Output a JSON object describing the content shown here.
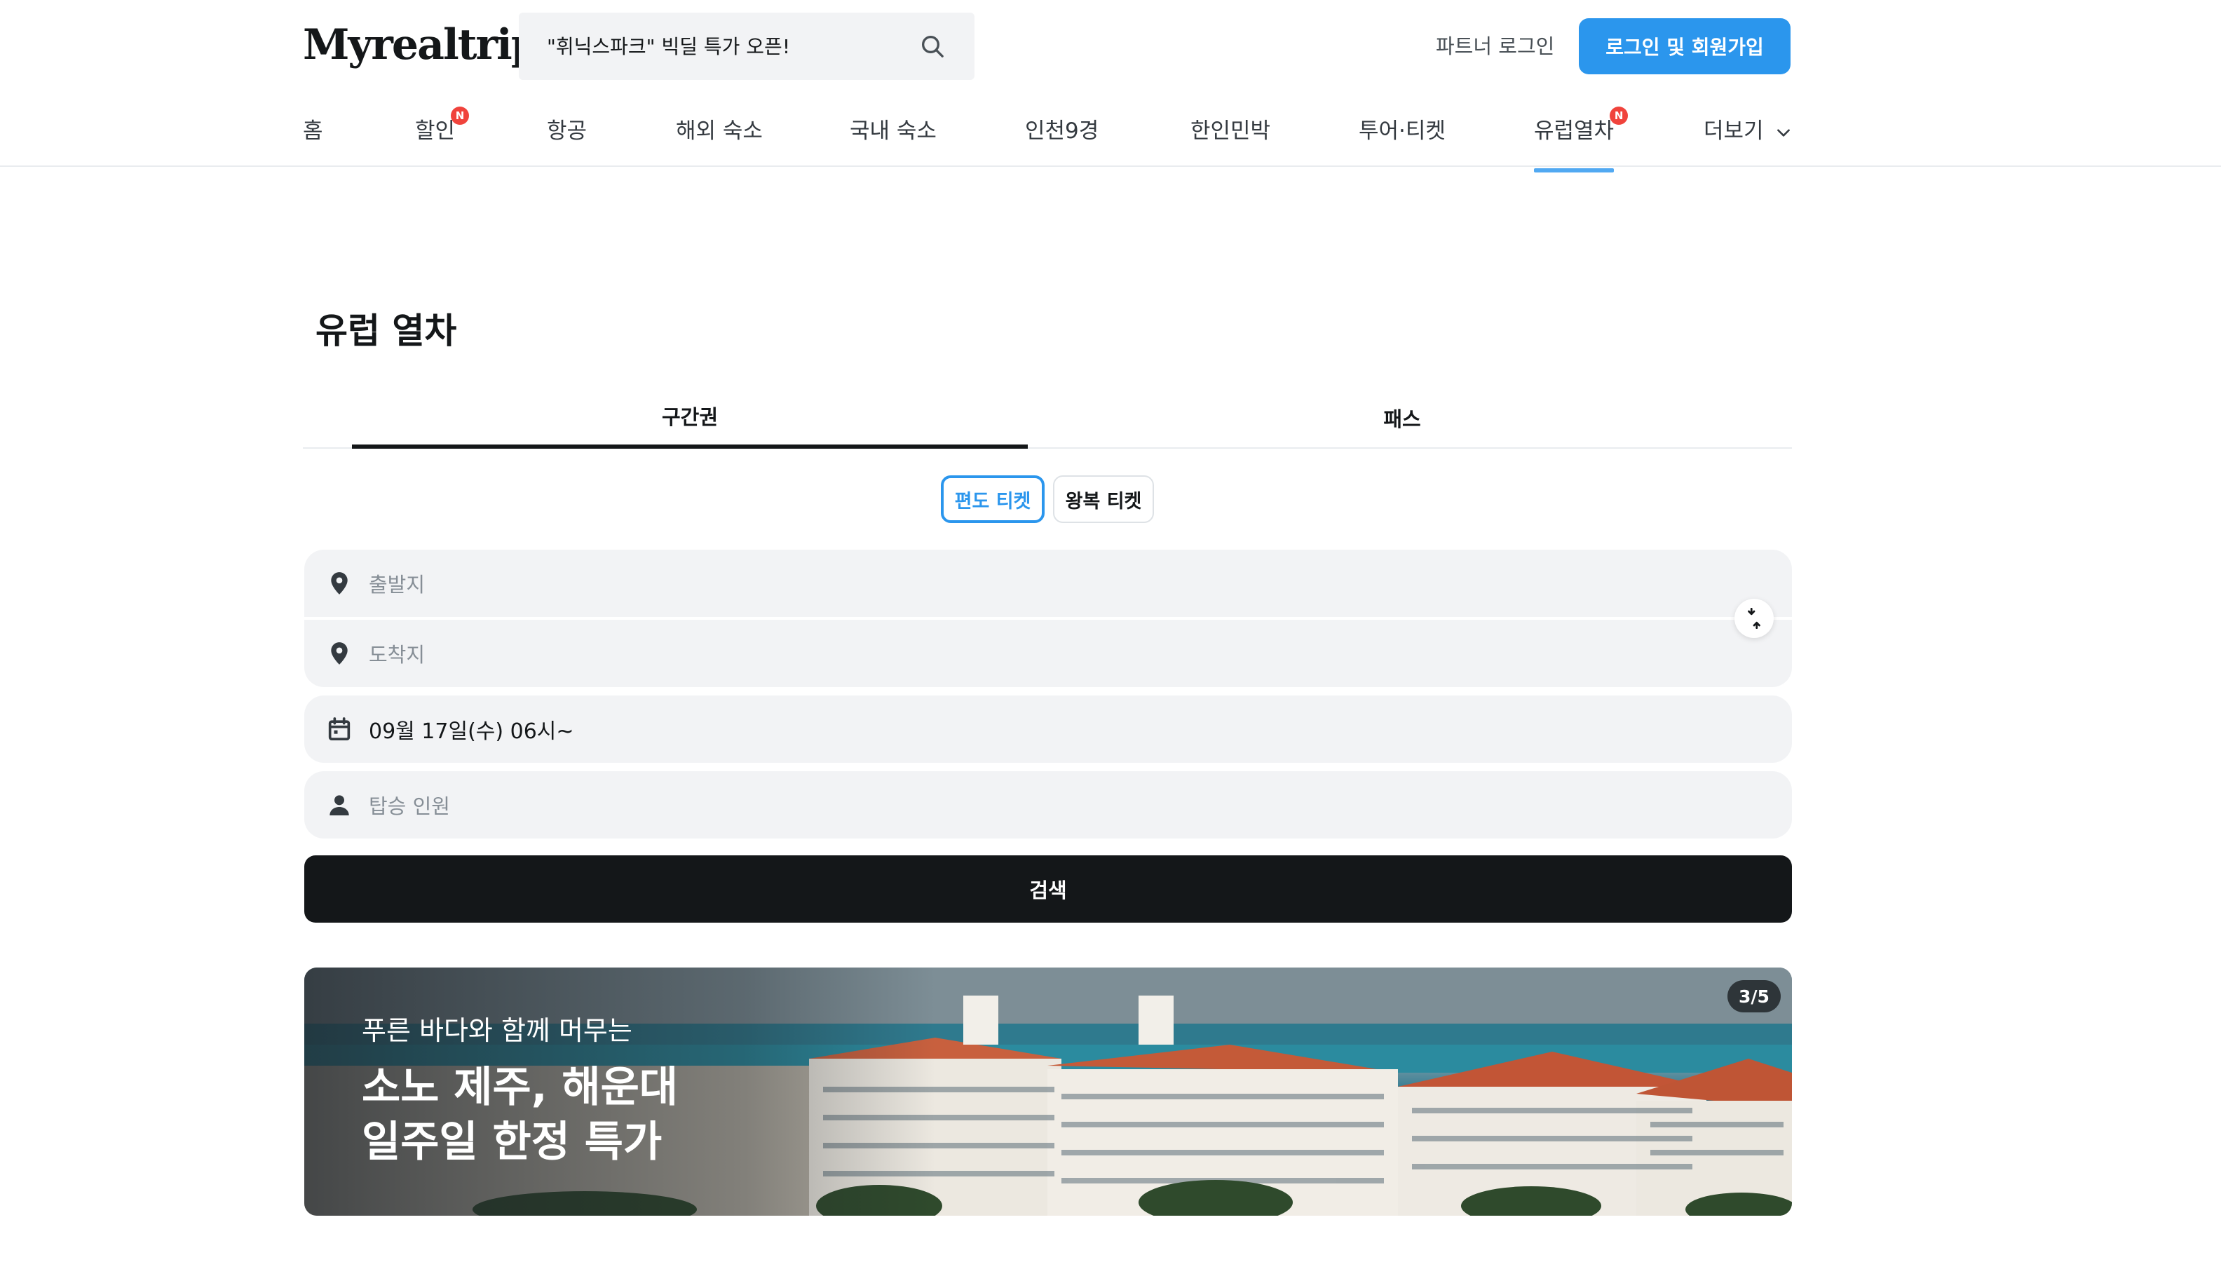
{
  "header": {
    "logo": "Myrealtrip",
    "search_placeholder": "\"휘닉스파크\" 빅딜 특가 오픈!",
    "partner_login": "파트너 로그인",
    "login_signup": "로그인 및 회원가입"
  },
  "nav": {
    "items": [
      {
        "label": "홈"
      },
      {
        "label": "할인",
        "badge": "N"
      },
      {
        "label": "항공"
      },
      {
        "label": "해외 숙소"
      },
      {
        "label": "국내 숙소"
      },
      {
        "label": "인천9경"
      },
      {
        "label": "한인민박"
      },
      {
        "label": "투어·티켓"
      },
      {
        "label": "유럽열차",
        "badge": "N",
        "active": true
      },
      {
        "label": "더보기"
      }
    ]
  },
  "page": {
    "title": "유럽 열차",
    "tabs": [
      {
        "label": "구간권",
        "active": true
      },
      {
        "label": "패스"
      }
    ],
    "ticket_types": [
      {
        "label": "편도 티켓",
        "selected": true
      },
      {
        "label": "왕복 티켓"
      }
    ],
    "form": {
      "departure_placeholder": "출발지",
      "arrival_placeholder": "도착지",
      "date_value": "09월 17일(수) 06시~",
      "passengers_placeholder": "탑승 인원",
      "search_label": "검색"
    }
  },
  "banner": {
    "subtitle": "푸른 바다와 함께 머무는",
    "title": "소노 제주, 해운대\n일주일 한정 특가",
    "counter": "3/5"
  },
  "colors": {
    "accent": "#2b96ed",
    "badge": "#f0433c",
    "dark": "#141719",
    "field_bg": "#f2f3f5"
  }
}
